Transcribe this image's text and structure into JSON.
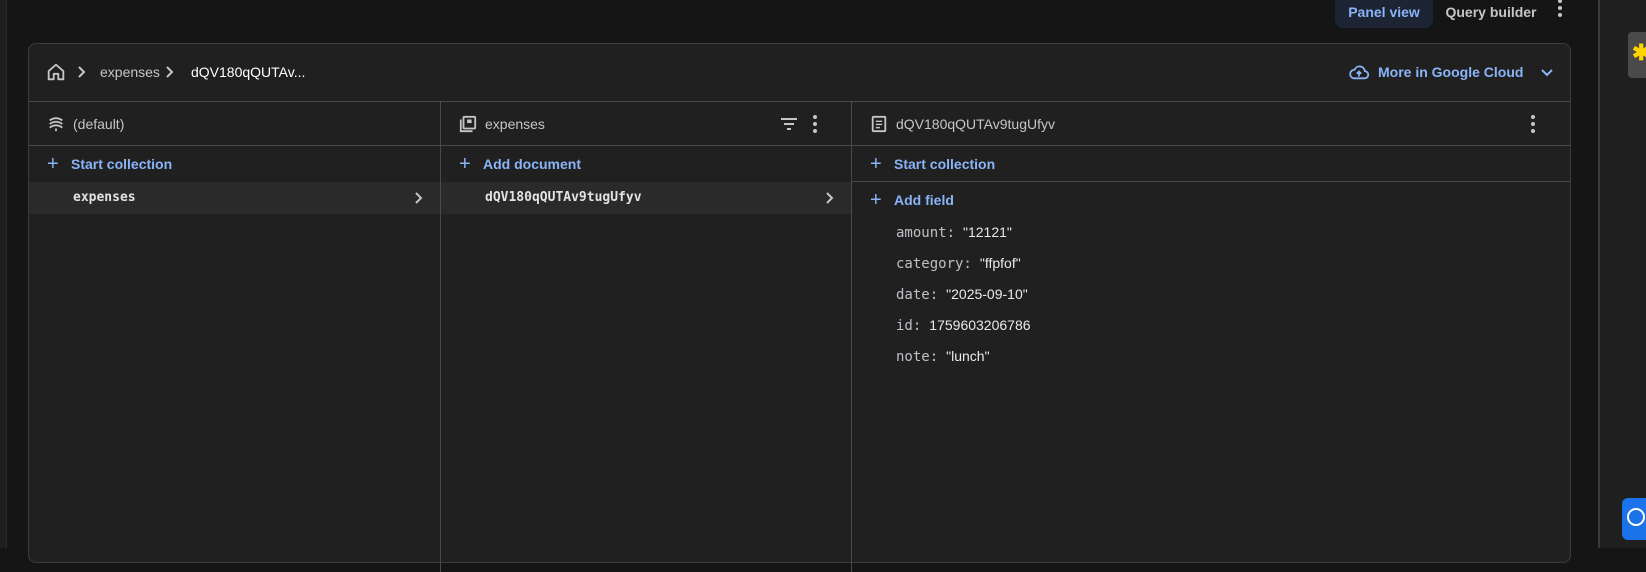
{
  "top_tabs": {
    "panel_view": "Panel view",
    "query_builder": "Query builder"
  },
  "breadcrumb": {
    "collection": "expenses",
    "document": "dQV180qQUTAv..."
  },
  "google_cloud_link": "More in Google Cloud",
  "database_column": {
    "title": "(default)",
    "action": "Start collection",
    "items": [
      "expenses"
    ]
  },
  "collection_column": {
    "title": "expenses",
    "action": "Add document",
    "items": [
      "dQV180qQUTAv9tugUfyv"
    ]
  },
  "document_column": {
    "title": "dQV180qQUTAv9tugUfyv",
    "start_collection": "Start collection",
    "add_field": "Add field",
    "fields": [
      {
        "key": "amount:",
        "value": "\"12121\""
      },
      {
        "key": "category:",
        "value": "\"ffpfof\""
      },
      {
        "key": "date:",
        "value": "\"2025-09-10\""
      },
      {
        "key": "id:",
        "value": "1759603206786"
      },
      {
        "key": "note:",
        "value": "\"lunch\""
      }
    ]
  },
  "colors": {
    "accent": "#8ab4f8",
    "background": "#202020",
    "page": "#151515"
  }
}
